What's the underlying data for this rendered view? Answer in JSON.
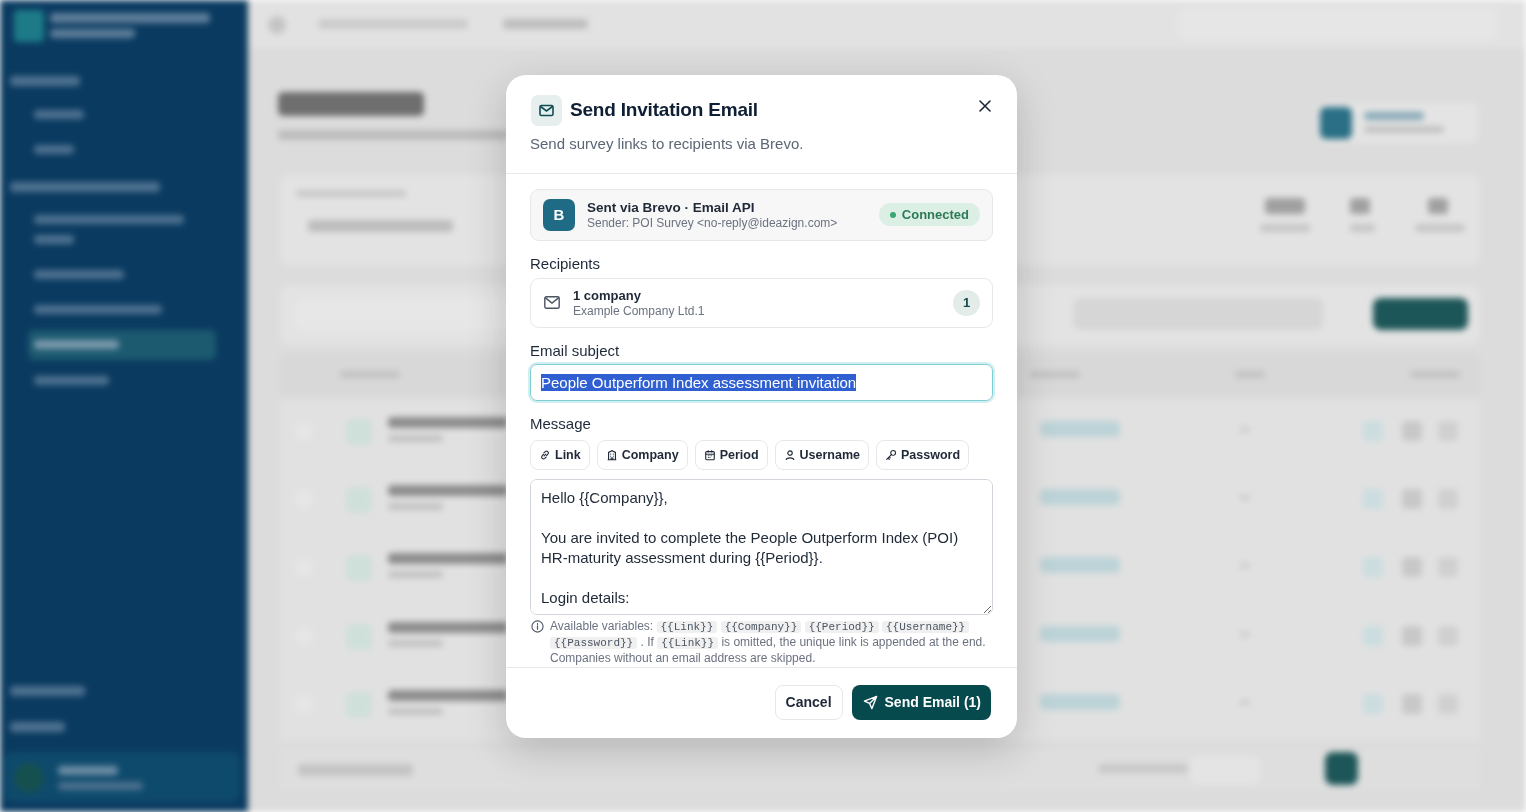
{
  "dialog": {
    "title": "Send Invitation Email",
    "subtitle": "Send survey links to recipients via Brevo.",
    "provider": {
      "initial": "B",
      "name": "Sent via Brevo · Email API",
      "sender": "Sender: POI Survey <no-reply@ideazign.com>",
      "status": {
        "label": "Connected",
        "connected": true
      }
    },
    "recipients": {
      "label": "Recipients",
      "summary": "1 company",
      "names": "Example Company Ltd.1",
      "count": "1"
    },
    "subject": {
      "label": "Email subject",
      "value": "People Outperform Index assessment invitation",
      "focused": true,
      "text_selected": true
    },
    "message": {
      "label": "Message",
      "variable_buttons": [
        {
          "label": "Link"
        },
        {
          "label": "Company"
        },
        {
          "label": "Period"
        },
        {
          "label": "Username"
        },
        {
          "label": "Password"
        }
      ],
      "value": "Hello {{Company}},\n\nYou are invited to complete the People Outperform Index (POI)\nHR-maturity assessment during {{Period}}.\n\nLogin details:"
    },
    "hint": [
      {
        "kind": "text",
        "text": "Available variables:"
      },
      {
        "kind": "code",
        "text": "{{Link}}"
      },
      {
        "kind": "code",
        "text": "{{Company}}"
      },
      {
        "kind": "code",
        "text": "{{Period}}"
      },
      {
        "kind": "code",
        "text": "{{Username}}"
      },
      {
        "kind": "code",
        "text": "{{Password}}"
      },
      {
        "kind": "text",
        "text": ". If"
      },
      {
        "kind": "code",
        "text": "{{Link}}"
      },
      {
        "kind": "text",
        "text": "is omitted, the unique link is appended at the end. Companies without an email address are skipped."
      }
    ],
    "buttons": [
      {
        "label": "Cancel",
        "kind": "secondary"
      },
      {
        "label": "Send Email (1)",
        "kind": "primary"
      }
    ]
  }
}
